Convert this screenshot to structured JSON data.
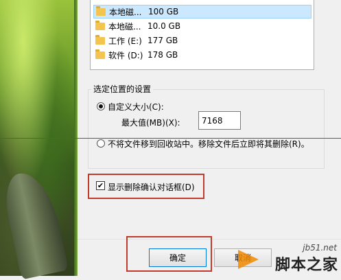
{
  "drives": [
    {
      "name": "本地磁...",
      "size": "100 GB",
      "selected": true
    },
    {
      "name": "本地磁...",
      "size": "10.0 GB",
      "selected": false
    },
    {
      "name": "工作 (E:)",
      "size": "177 GB",
      "selected": false
    },
    {
      "name": "软件 (D:)",
      "size": "178 GB",
      "selected": false
    }
  ],
  "settings": {
    "group_title": "选定位置的设置",
    "custom_size_label": "自定义大小(C):",
    "max_value_label": "最大值(MB)(X):",
    "max_value": "7168",
    "no_recycle_label": "不将文件移到回收站中。移除文件后立即将其删除(R)。"
  },
  "confirm_dialog": {
    "label": "显示删除确认对话框(D)",
    "checked": "✔"
  },
  "buttons": {
    "ok": "确定",
    "cancel": "取消"
  },
  "watermark": {
    "site": "jb51.net",
    "main": "脚本之家"
  },
  "colors": {
    "highlight_box": "#c0392b",
    "selection": "#cce8ff"
  }
}
